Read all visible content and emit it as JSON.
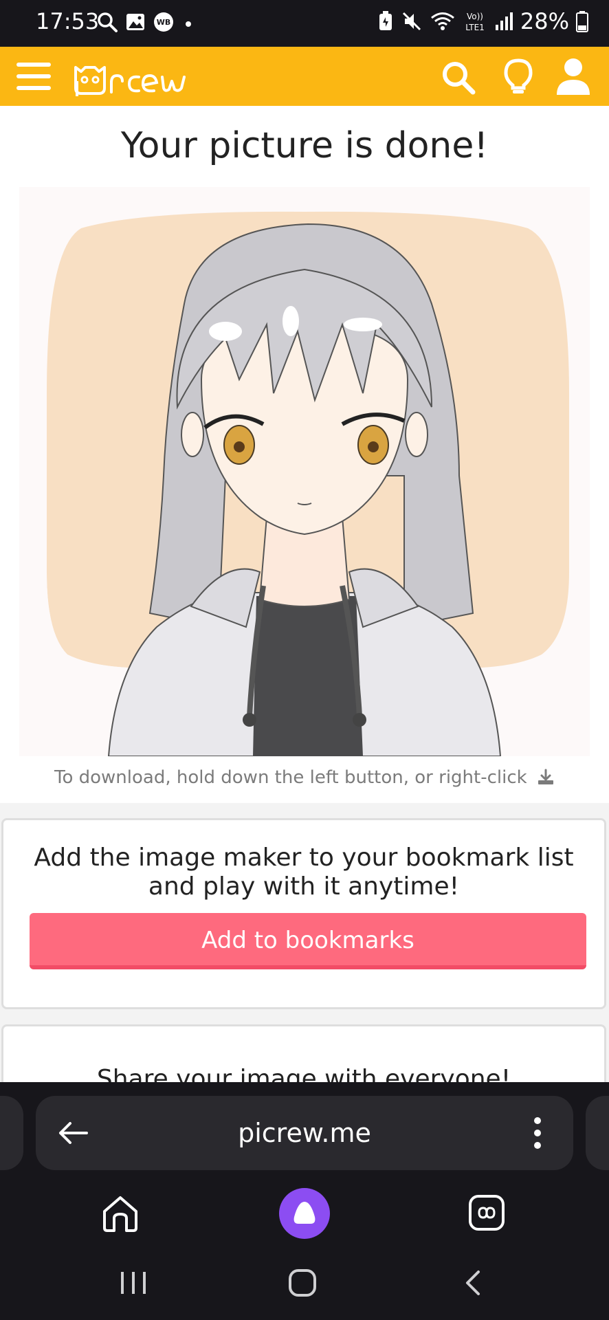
{
  "status_bar": {
    "time": "17:53",
    "battery": "28%",
    "network_label": "Vo)) LTE1",
    "icons": [
      "search-icon",
      "gallery-icon",
      "wb-icon",
      "dot-icon",
      "battery-saver-icon",
      "mute-icon",
      "wifi-icon",
      "lte-icon",
      "signal-icon",
      "battery-icon"
    ]
  },
  "appbar": {
    "brand": "Picrew",
    "icons": [
      "menu-icon",
      "search-icon",
      "lightbulb-icon",
      "profile-icon"
    ],
    "color": "#fbb713"
  },
  "result": {
    "title": "Your picture is done!",
    "download_hint": "To download, hold down the left button, or right-click"
  },
  "bookmark_card": {
    "line1": "Add the image maker to your bookmark list",
    "line2": "and play with it anytime!",
    "button_label": "Add to bookmarks",
    "button_color": "#fe6a7e"
  },
  "share_card": {
    "title": "Share your image with everyone!"
  },
  "browser": {
    "url": "picrew.me",
    "icons": [
      "back-arrow-icon",
      "more-vert-icon",
      "home-icon",
      "assistant-icon",
      "tabs-icon"
    ]
  },
  "system_nav": {
    "icons": [
      "recents-icon",
      "home-circle-icon",
      "back-chevron-icon"
    ]
  }
}
